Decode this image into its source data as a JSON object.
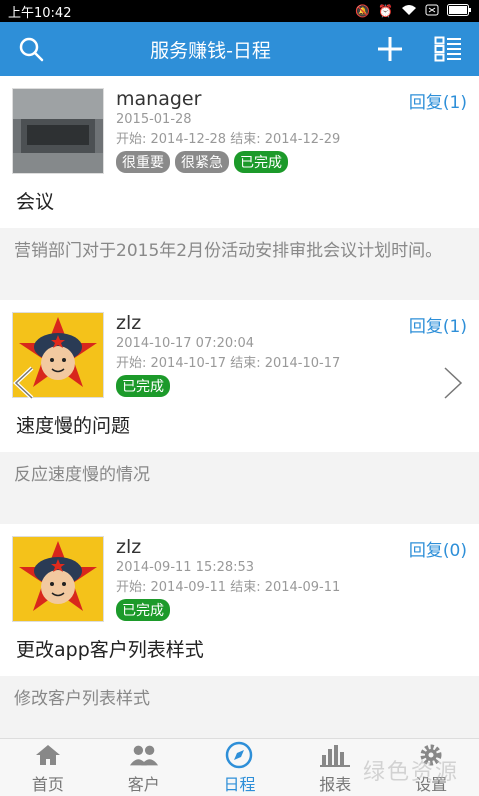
{
  "status": {
    "time": "上午10:42"
  },
  "header": {
    "title": "服务赚钱-日程"
  },
  "cards": [
    {
      "username": "manager",
      "date": "2015-01-28",
      "range": "开始: 2014-12-28  结束: 2014-12-29",
      "reply": "回复(1)",
      "tags": [
        "很重要",
        "很紧急",
        "已完成"
      ],
      "title": "会议",
      "body": "营销部门对于2015年2月份活动安排审批会议计划时间。"
    },
    {
      "username": "zlz",
      "date": "2014-10-17 07:20:04",
      "range": "开始: 2014-10-17  结束: 2014-10-17",
      "reply": "回复(1)",
      "tags": [
        "已完成"
      ],
      "title": "速度慢的问题",
      "body": "反应速度慢的情况"
    },
    {
      "username": "zlz",
      "date": "2014-09-11 15:28:53",
      "range": "开始: 2014-09-11  结束: 2014-09-11",
      "reply": "回复(0)",
      "tags": [
        "已完成"
      ],
      "title": "更改app客户列表样式",
      "body": "修改客户列表样式"
    }
  ],
  "tabs": [
    {
      "label": "首页",
      "icon": "home-icon"
    },
    {
      "label": "客户",
      "icon": "customers-icon"
    },
    {
      "label": "日程",
      "icon": "compass-icon"
    },
    {
      "label": "报表",
      "icon": "chart-icon"
    },
    {
      "label": "设置",
      "icon": "gear-icon"
    }
  ],
  "watermark": "绿色资源",
  "colors": {
    "accent": "#2e8fd8",
    "done": "#1c9a2a",
    "tag_gray": "#8a8a8a"
  }
}
